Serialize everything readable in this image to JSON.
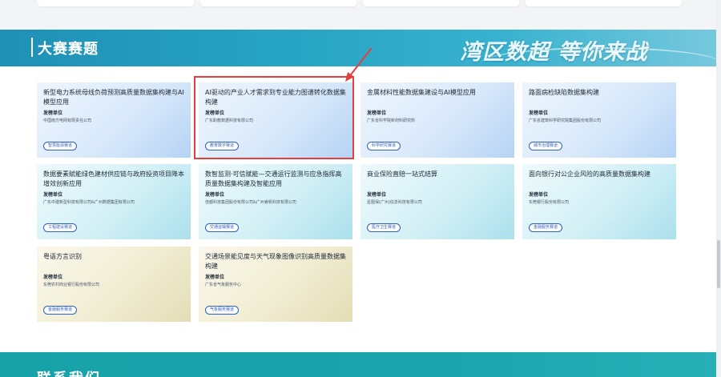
{
  "banner": {
    "title": "大赛赛题",
    "slogan": "湾区数超 等你来战"
  },
  "org_label": "发榜单位",
  "cards": [
    {
      "title": "新型电力系统母线负荷预测高质量数据集构建与AI模型应用",
      "org": "中国南方电网有限责任公司",
      "tag": "智慧能源赛道",
      "theme": "blue"
    },
    {
      "title": "AI驱动的产业人才需求到专业能力图谱转化数据集构建",
      "org": "广东职教数据科技有限公司",
      "tag": "教育数字赛道",
      "theme": "blue"
    },
    {
      "title": "金属材料性能数据集建设与AI模型应用",
      "org": "广东省科学院新材料研究所",
      "tag": "科学研究赛道",
      "theme": "blue"
    },
    {
      "title": "路面病检缺陷数据集构建",
      "org": "广东省建筑科学研究院集团股份有限公司",
      "tag": "城市治理赛道",
      "theme": "blue"
    },
    {
      "title": "数据要素赋能绿色建材供应链与政府投资项目降本增效创新应用",
      "org": "广东中建新型科技有限公司&广州数据集团有限公司",
      "tag": "工程建设赛道",
      "theme": "cyan"
    },
    {
      "title": "数智监测·可信赋能—交通运行监测与应急指挥高质量数据集构建及智能应用",
      "org": "佳都科技集团股份有限公司&广州睿帆科技有限公司",
      "tag": "交通运输赛道",
      "theme": "cyan"
    },
    {
      "title": "商业保险直赔一站式结算",
      "org": "星图保(广州)信息科技有限公司",
      "tag": "医疗卫生赛道",
      "theme": "cyan"
    },
    {
      "title": "面向银行对公企业风险的高质量数据集构建",
      "org": "东莞银行股份有限公司",
      "tag": "金融服务赛道",
      "theme": "cyan"
    },
    {
      "title": "粤语方言识别",
      "org": "东莞农村商业银行股份有限公司",
      "tag": "金融服务赛道",
      "theme": "beige"
    },
    {
      "title": "交通场景能见度与天气现象图像识别高质量数据集构建",
      "org": "广东省气象服务中心",
      "tag": "气象服务赛道",
      "theme": "beige"
    }
  ],
  "footer": {
    "title": "联系我们"
  },
  "colors": {
    "banner_start": "#1f90b6",
    "highlight": "#e53e3e",
    "tag_border": "#2f5fbf",
    "footer": "#17a2a8"
  }
}
